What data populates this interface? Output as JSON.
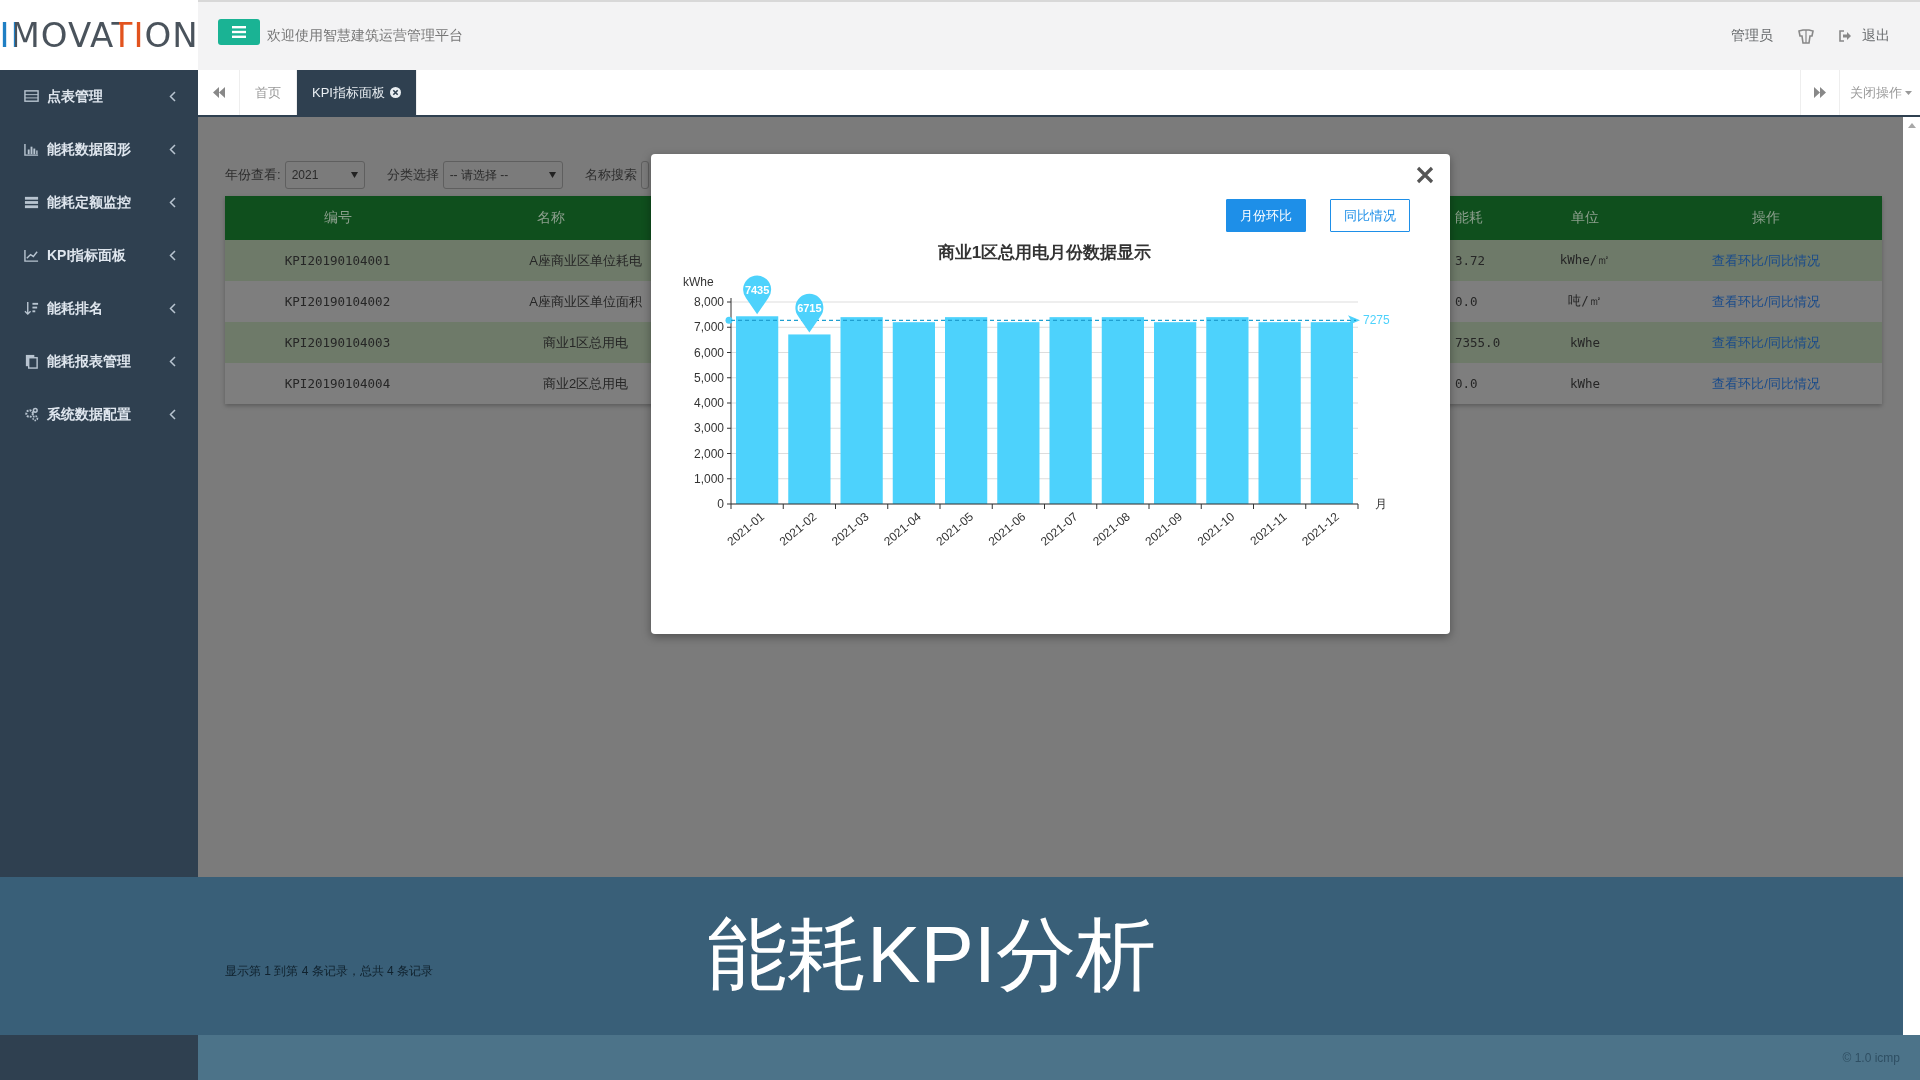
{
  "header": {
    "logo": "IMOVATION",
    "welcome": "欢迎使用智慧建筑运营管理平台",
    "user": "管理员",
    "logout": "退出"
  },
  "sidebar": {
    "items": [
      {
        "label": "点表管理"
      },
      {
        "label": "能耗数据图形"
      },
      {
        "label": "能耗定额监控"
      },
      {
        "label": "KPI指标面板"
      },
      {
        "label": "能耗排名"
      },
      {
        "label": "能耗报表管理"
      },
      {
        "label": "系统数据配置"
      }
    ]
  },
  "tabs": [
    {
      "label": "首页",
      "selected": false,
      "closable": false
    },
    {
      "label": "KPI指标面板",
      "selected": true,
      "closable": true
    }
  ],
  "tab_actions": {
    "close_menu": "关闭操作"
  },
  "filters": [
    {
      "kind": "select",
      "label": "年份查看:",
      "value": "2021"
    },
    {
      "kind": "select",
      "label": "分类选择",
      "value": "-- 请选择 --"
    },
    {
      "kind": "input",
      "label": "名称搜索"
    }
  ],
  "table": {
    "columns": [
      "编号",
      "名称",
      "能耗",
      "单位",
      "操作"
    ],
    "rows": [
      {
        "cells": [
          "KPI20190104001",
          "A座商业区单位耗电",
          "3.72",
          "kWhe/㎡",
          "查看环比/同比情况"
        ]
      },
      {
        "cells": [
          "KPI20190104002",
          "A座商业区单位面积",
          "0.0",
          "吨/㎡",
          "查看环比/同比情况"
        ]
      },
      {
        "cells": [
          "KPI20190104003",
          "商业1区总用电",
          "7355.0",
          "kWhe",
          "查看环比/同比情况"
        ]
      },
      {
        "cells": [
          "KPI20190104004",
          "商业2区总用电",
          "0.0",
          "kWhe",
          "查看环比/同比情况"
        ]
      }
    ]
  },
  "modal": {
    "buttons": [
      {
        "label": "月份环比",
        "selected": true
      },
      {
        "label": "同比情况",
        "selected": false
      }
    ],
    "chart_data": {
      "type": "bar",
      "title": "商业1区总用电月份数据显示",
      "xlabel": "月",
      "ylabel": "kWhe",
      "categories": [
        "2021-01",
        "2021-02",
        "2021-03",
        "2021-04",
        "2021-05",
        "2021-06",
        "2021-07",
        "2021-08",
        "2021-09",
        "2021-10",
        "2021-11",
        "2021-12"
      ],
      "series": [
        {
          "color": "#4dd2fc",
          "values": [
            7435,
            6715,
            7400,
            7200,
            7400,
            7200,
            7400,
            7400,
            7200,
            7400,
            7200,
            7200
          ]
        }
      ],
      "grid": true,
      "ylim": [
        0,
        8000
      ],
      "yticks": [
        {
          "value": 0,
          "label": "0"
        },
        {
          "value": 1000,
          "label": "1,000"
        },
        {
          "value": 2000,
          "label": "2,000"
        },
        {
          "value": 3000,
          "label": "3,000"
        },
        {
          "value": 4000,
          "label": "4,000"
        },
        {
          "value": 5000,
          "label": "5,000"
        },
        {
          "value": 6000,
          "label": "6,000"
        },
        {
          "value": 7000,
          "label": "7,000"
        },
        {
          "value": 8000,
          "label": "8,000"
        }
      ],
      "annotations": [
        {
          "x": "2021-01",
          "y": 7435,
          "text": "7435"
        },
        {
          "x": "2021-02",
          "y": 6715,
          "text": "6715"
        }
      ],
      "ref_lines": [
        {
          "axis": "y",
          "value": 7275,
          "label": "7275"
        }
      ]
    }
  },
  "pagination": "显示第 1 到第 4 条记录，总共 4 条记录",
  "caption": "能耗KPI分析",
  "footer": "© 1.0 icmp"
}
